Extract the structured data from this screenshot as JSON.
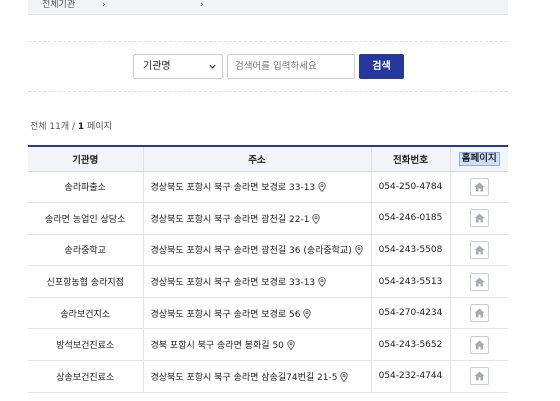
{
  "breadcrumb": {
    "items": [
      "전체기관",
      "",
      ""
    ]
  },
  "search": {
    "category_selected": "기관명",
    "input_placeholder": "검색어를 입력하세요",
    "input_value": "",
    "button_label": "검색"
  },
  "summary": {
    "prefix": "전체 11개 / ",
    "page": "1",
    "suffix": " 페이지"
  },
  "table": {
    "headers": [
      "기관명",
      "주소",
      "전화번호",
      "홈페이지"
    ],
    "rows": [
      {
        "name": "송라파출소",
        "address": "경상북도 포항시 북구 송라면 보경로 33-13",
        "phone": "054-250-4784"
      },
      {
        "name": "송라면 농업인 상담소",
        "address": "경상북도 포항시 북구 송라면 광천길 22-1",
        "phone": "054-246-0185"
      },
      {
        "name": "송라중학교",
        "address": "경상북도 포항시 북구 송라면 광천길 36 (송라중학교)",
        "phone": "054-243-5508"
      },
      {
        "name": "신포항농협 송라지점",
        "address": "경상북도 포항시 북구 송라면 보경로 33-13",
        "phone": "054-243-5513"
      },
      {
        "name": "송라보건지소",
        "address": "경상북도 포항시 북구 송라면 보경로 56",
        "phone": "054-270-4234"
      },
      {
        "name": "방석보건진료소",
        "address": "경북 포항시 북구 송라면 봉화길 50",
        "phone": "054-243-5652"
      },
      {
        "name": "상송보건진료소",
        "address": "경상북도 포항시 북구 송라면 삼송길74번길 21-5",
        "phone": "054-232-4744"
      }
    ]
  },
  "colors": {
    "accent": "#26389b",
    "header_bg": "#f4f5f8",
    "highlight": "#cfe0ff"
  },
  "icons": {
    "row_location": "location-pin-icon",
    "row_homepage": "home-icon",
    "select_arrow": "chevron-down-icon"
  }
}
